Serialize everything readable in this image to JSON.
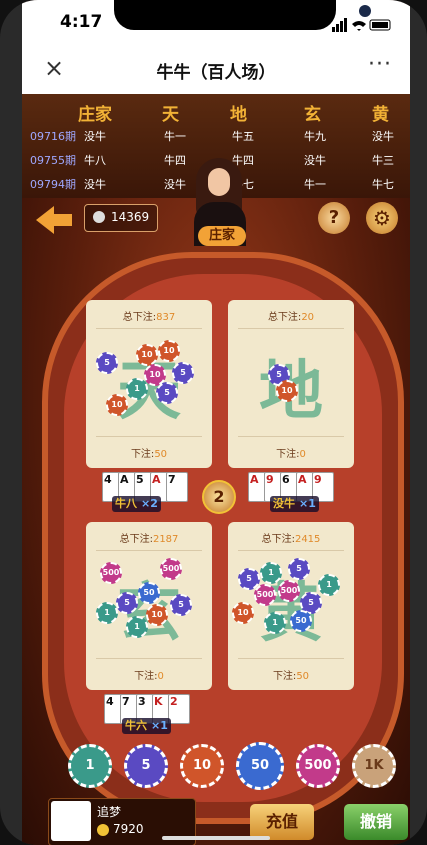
{
  "status": {
    "time": "4:17"
  },
  "nav": {
    "close": "×",
    "title": "牛牛（百人场）",
    "more": "···"
  },
  "history": {
    "headers": [
      "庄家",
      "天",
      "地",
      "玄",
      "黄"
    ],
    "rows": [
      {
        "period": "09716期",
        "cols": [
          "没牛",
          "牛一",
          "牛五",
          "牛九",
          "没牛"
        ]
      },
      {
        "period": "09755期",
        "cols": [
          "牛八",
          "牛四",
          "牛四",
          "没牛",
          "牛三"
        ]
      },
      {
        "period": "09794期",
        "cols": [
          "没牛",
          "没牛",
          "牛七",
          "牛一",
          "牛七"
        ]
      }
    ]
  },
  "top": {
    "online_count": "14369",
    "dealer_label": "庄家",
    "help": "?",
    "gear": "⚙"
  },
  "panels": [
    {
      "total_label": "总下注:",
      "total": "837",
      "glyph": "天",
      "bet_label": "下注:",
      "bet": "50"
    },
    {
      "total_label": "总下注:",
      "total": "20",
      "glyph": "地",
      "bet_label": "下注:",
      "bet": "0"
    },
    {
      "total_label": "总下注:",
      "total": "2187",
      "glyph": "玄",
      "bet_label": "下注:",
      "bet": "0"
    },
    {
      "total_label": "总下注:",
      "total": "2415",
      "glyph": "黄",
      "bet_label": "下注:",
      "bet": "50"
    }
  ],
  "hands": [
    {
      "cards": [
        "4",
        "A",
        "5",
        "A",
        "7"
      ],
      "result": "牛八",
      "mul": "×2"
    },
    {
      "cards": [
        "A",
        "9",
        "6",
        "A",
        "9"
      ],
      "result": "没牛",
      "mul": "×1"
    },
    {
      "cards": [
        "4",
        "7",
        "3",
        "K",
        "2"
      ],
      "result": "牛六",
      "mul": "×1"
    }
  ],
  "round_number": "2",
  "chips": [
    "1",
    "5",
    "10",
    "50",
    "500",
    "1K"
  ],
  "player": {
    "name": "追梦",
    "money": "7920"
  },
  "buttons": {
    "recharge": "充值",
    "cancel": "撤销"
  }
}
